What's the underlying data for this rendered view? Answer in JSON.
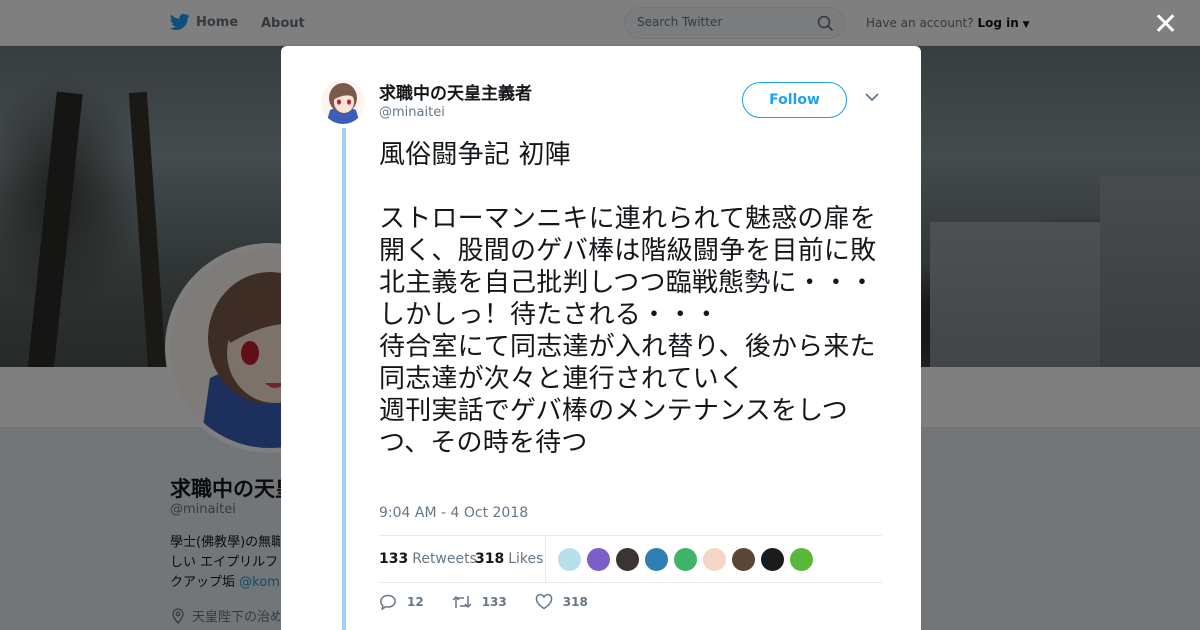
{
  "topbar": {
    "home_label": "Home",
    "about_label": "About",
    "search_placeholder": "Search Twitter",
    "account_prompt": "Have an account?",
    "login_label": "Log in"
  },
  "profile": {
    "name": "求職中の天皇",
    "handle": "@minaitei",
    "bio_line1": "學士(佛教學)の無職",
    "bio_line2": "しい エイプリルフ",
    "bio_line3_prefix": "クアップ垢 ",
    "bio_link": "@kom",
    "location": "天皇陛下の治め"
  },
  "tweet": {
    "author_name": "求職中の天皇主義者",
    "author_handle": "@minaitei",
    "follow_label": "Follow",
    "text": "風俗闘争記 初陣\n\nストローマンニキに連れられて魅惑の扉を開く、股間のゲバ棒は階級闘争を目前に敗北主義を自己批判しつつ臨戦態勢に・・・\nしかしっ！待たされる・・・\n待合室にて同志達が入れ替り、後から来た同志達が次々と連行されていく\n週刊実話でゲバ棒のメンテナンスをしつつ、その時を待つ",
    "timestamp": "9:04 AM - 4 Oct 2018",
    "retweets_count": "133",
    "retweets_label": "Retweets",
    "likes_count": "318",
    "likes_label": "Likes",
    "reply_count": "12",
    "retweet_action_count": "133",
    "like_action_count": "318"
  },
  "colors": {
    "accent": "#1da1f2",
    "thread_line": "#a0d0f4",
    "muted": "#657786",
    "liker_avatars": [
      "#b8e0ec",
      "#7a5fc8",
      "#3a3433",
      "#2f7fb5",
      "#3fb36a",
      "#f2d7c8",
      "#5a4636",
      "#1b1b1b",
      "#58b83a"
    ]
  }
}
